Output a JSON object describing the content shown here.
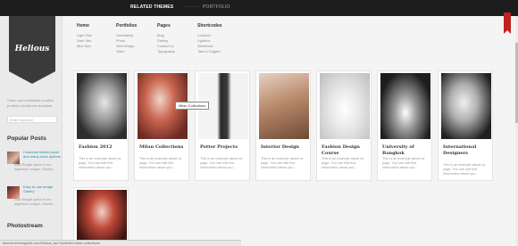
{
  "topbar": {
    "related_label": "RELATED THEMES",
    "dim_label": "———",
    "portfolio_label": "PORTFOLIO"
  },
  "sidebar": {
    "logo_text": "Helious",
    "tagline": "Clean and minimalist creative portfolio wordpress template.",
    "search_placeholder": "Enter keyword",
    "popular_title": "Popular Posts",
    "posts": [
      {
        "title": "Coloursie Admin panel and many more options",
        "excerpt": "Bala Ringlia quisa in lors dignissim congue. Mauris..."
      },
      {
        "title": "Easy to use Image Gallery",
        "excerpt": "Bala Ringlia quisa in lors dignissim congue. Mauris..."
      }
    ],
    "photostream_title": "Photostream"
  },
  "menu": {
    "columns": [
      {
        "head": "Home",
        "items": [
          "Light Skin",
          "Dark Skin",
          "Blue Skin"
        ]
      },
      {
        "head": "Portfolios",
        "items": [
          "Uncertainty",
          "Photo",
          "Web Design",
          "Video"
        ]
      },
      {
        "head": "Pages",
        "items": [
          "Blog",
          "Gallery",
          "Contact Us",
          "Typography"
        ]
      },
      {
        "head": "Shortcodes",
        "items": [
          "Columns",
          "Lightbox",
          "Slideshow",
          "Tabs & Toggles"
        ]
      }
    ]
  },
  "gallery": [
    {
      "title": "Fashion 2012",
      "desc": "This is an example about us page. You can edit this information about you..."
    },
    {
      "title": "Milan Collections",
      "desc": "This is an example about us page. You can edit this information about you..."
    },
    {
      "title": "Potter Projects",
      "desc": "This is an example about us page. You can edit this information about you..."
    },
    {
      "title": "Interior Design",
      "desc": "This is an example about us page. You can edit this information about you..."
    },
    {
      "title": "Fashion Design Course",
      "desc": "This is an example about us page. You can edit this information about you..."
    },
    {
      "title": "University of Bangkok",
      "desc": "This is an example about us page. You can edit this information about you..."
    },
    {
      "title": "International Designers",
      "desc": "This is an example about us page. You can edit this information about you..."
    },
    {
      "title": "",
      "desc": ""
    }
  ],
  "tooltip": "Milan Collections",
  "statusbar": "themes.themeguide.com/helious_wp/?portfolio=milan-collections",
  "colors": {
    "accent": "#c0211f",
    "link": "#2a8aa6",
    "topbar": "#1d1d1d"
  }
}
